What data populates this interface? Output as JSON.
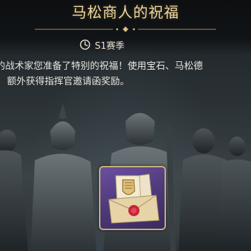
{
  "header": {
    "title": "马松商人的祝福",
    "season_label": "S1赛季",
    "season_icon": "clock-icon"
  },
  "description": {
    "line1": "的战术家您准备了特别的祝福！使用宝石、马松德",
    "line2": "额外获得指挥官邀请函奖励。"
  },
  "reward": {
    "icon": "invitation-letter-icon",
    "frame_color": "#6b4fa0"
  },
  "colors": {
    "title_gold": "#f1d79a",
    "text": "#e8e6df"
  }
}
